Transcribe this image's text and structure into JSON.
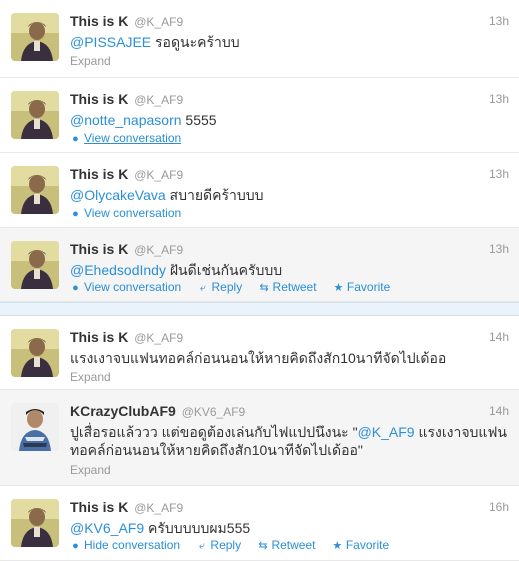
{
  "tweets": [
    {
      "name": "This is K",
      "handle": "@K_AF9",
      "time": "13h",
      "mention": "@PISSAJEE",
      "body": " รอดูนะคร้าบบ",
      "action": "Expand"
    },
    {
      "name": "This is K",
      "handle": "@K_AF9",
      "time": "13h",
      "mention": "@notte_napasorn",
      "body": " 5555",
      "action": "View conversation"
    },
    {
      "name": "This is K",
      "handle": "@K_AF9",
      "time": "13h",
      "mention": "@OlycakeVava",
      "body": " สบายดีคร้าบบบ",
      "action": "View conversation"
    },
    {
      "name": "This is K",
      "handle": "@K_AF9",
      "time": "13h",
      "mention": "@EhedsodIndy",
      "body": " ฝันดีเช่นกันครับบบ",
      "action": "View conversation",
      "reply": "Reply",
      "retweet": "Retweet",
      "favorite": "Favorite"
    },
    {
      "name": "This is K",
      "handle": "@K_AF9",
      "time": "14h",
      "body": "แรงเงาจบแฟนทอคล์ก่อนนอนให้หายคิดถึงสัก10นาทีจัดไปเด้ออ",
      "action": "Expand"
    },
    {
      "name": "KCrazyClubAF9",
      "handle": "@KV6_AF9",
      "time": "14h",
      "line1_pre": "ปูเสื่อรอแล้ววว แต่ขอดูต้องเล่นกับไฟแปปนึงนะ \"",
      "mention": "@K_AF9",
      "line1_post": " แรงเงาจบแฟน",
      "line2": "ทอคล์ก่อนนอนให้หายคิดถึงสัก10นาทีจัดไปเด้ออ\"",
      "action": "Expand"
    },
    {
      "name": "This is K",
      "handle": "@K_AF9",
      "time": "16h",
      "mention": "@KV6_AF9",
      "body": " ครับบบบบผม555",
      "action": "Hide conversation",
      "reply": "Reply",
      "retweet": "Retweet",
      "favorite": "Favorite"
    }
  ],
  "colors": {
    "link": "#2a8fd8",
    "muted": "#999999",
    "text": "#333333"
  },
  "icons": {
    "conversation": "speech-bubble-icon",
    "reply": "reply-arrow-icon",
    "retweet": "retweet-icon",
    "favorite": "star-icon"
  }
}
